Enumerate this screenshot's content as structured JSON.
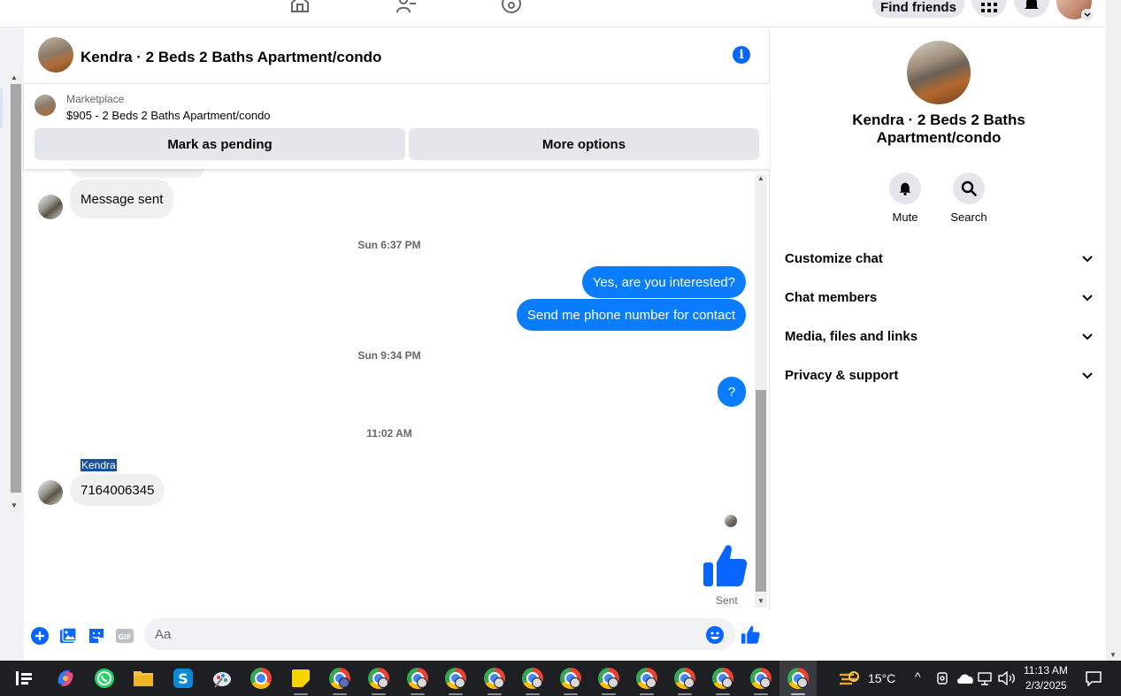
{
  "topnav": {
    "find_friends": "Find friends"
  },
  "chat": {
    "title": "Kendra · 2 Beds 2 Baths Apartment/condo",
    "marketplace_label": "Marketplace",
    "listing": "$905 - 2 Beds 2 Baths Apartment/condo",
    "mark_pending": "Mark as pending",
    "more_options": "More options",
    "messages": {
      "message_sent": "Message sent",
      "ts1": "Sun 6:37 PM",
      "out1": "Yes, are you interested?",
      "out2": "Send me phone number for contact",
      "ts2": "Sun 9:34 PM",
      "out3": "?",
      "ts3": "11:02 AM",
      "sender": "Kendra",
      "in_phone": "7164006345",
      "sent_status": "Sent"
    },
    "composer_placeholder": "Aa"
  },
  "panel": {
    "title": "Kendra · 2 Beds 2 Baths Apartment/condo",
    "mute": "Mute",
    "search": "Search",
    "sections": [
      "Customize chat",
      "Chat members",
      "Media, files and links",
      "Privacy & support"
    ]
  },
  "taskbar": {
    "temperature": "15°C",
    "time": "11:13 AM",
    "date": "2/3/2025"
  },
  "colors": {
    "accent": "#0866ff",
    "bubble_out": "#0a7cff",
    "bubble_in": "#f0f0f0",
    "taskbar": "#1e1f23"
  },
  "icons": [
    "home-icon",
    "friends-icon",
    "groups-icon",
    "menu-grid-icon",
    "bell-icon",
    "info-icon",
    "plus-icon",
    "photo-icon",
    "sticker-icon",
    "gif-icon",
    "emoji-icon",
    "thumbs-up-icon",
    "search-icon",
    "chevron-down-icon"
  ]
}
